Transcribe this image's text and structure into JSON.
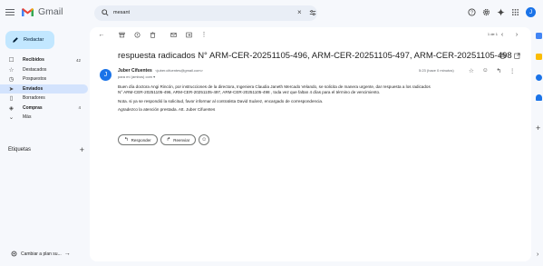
{
  "app": {
    "name": "Gmail"
  },
  "search": {
    "query": "mesant",
    "clear_icon": "×"
  },
  "compose": {
    "label": "Redactar"
  },
  "nav": [
    {
      "key": "inbox",
      "icon": "inbox-icon",
      "glyph": "☐",
      "label": "Recibidos",
      "count": "42",
      "active": false,
      "bold": true
    },
    {
      "key": "starred",
      "icon": "star-icon",
      "glyph": "☆",
      "label": "Destacados",
      "count": "",
      "active": false,
      "bold": false
    },
    {
      "key": "snoozed",
      "icon": "clock-icon",
      "glyph": "◷",
      "label": "Pospuestos",
      "count": "",
      "active": false,
      "bold": false
    },
    {
      "key": "sent",
      "icon": "send-icon",
      "glyph": "➤",
      "label": "Enviados",
      "count": "",
      "active": true,
      "bold": true
    },
    {
      "key": "drafts",
      "icon": "draft-icon",
      "glyph": "▯",
      "label": "Borradores",
      "count": "",
      "active": false,
      "bold": false
    },
    {
      "key": "purchases",
      "icon": "tag-icon",
      "glyph": "◈",
      "label": "Compras",
      "count": "4",
      "active": false,
      "bold": true
    },
    {
      "key": "more",
      "icon": "chevron-down-icon",
      "glyph": "⌄",
      "label": "Más",
      "count": "",
      "active": false,
      "bold": false
    }
  ],
  "labels": {
    "title": "Etiquetas"
  },
  "switch": {
    "label": "Cambiar a plan su..."
  },
  "pager": {
    "text": "1 de 1"
  },
  "email": {
    "subject": "respuesta radicados N° ARM-CER-20251105-496, ARM-CER-20251105-497, ARM-CER-20251105-498",
    "sender_name": "Juber Cifuentes",
    "sender_email": "<juber.cifuentes@gmail.com>",
    "to": "para mí (ambos) com ▾",
    "date": "5:23 (hace 0 minutos)",
    "avatar_letter": "J",
    "body": [
      "Buen día doctora Angi Rincón, por instrucciones de la directora, Ingeniera Claudia Janeth Mercado Velando, se solicita de manera urgente, dar respuesta a los radicados",
      "N° ARM-CER-20251105-496, ARM-CER-20251105-497, ARM-CER-20251105-498 , toda vez que faltan 4 días para el término de vencimiento.",
      "Nota. si ya se respondió la solicitud, favor informar al contratista David Suárez, encargado de correspondencia.",
      "Agradezco la atención prestada. Att. Juber Cifuentes"
    ],
    "reply_label": "Responder",
    "forward_label": "Reenviar"
  },
  "user": {
    "avatar_letter": "J"
  },
  "colors": {
    "accent": "#1a73e8",
    "compose_bg": "#c2e7ff",
    "active_nav": "#d3e3fd"
  }
}
